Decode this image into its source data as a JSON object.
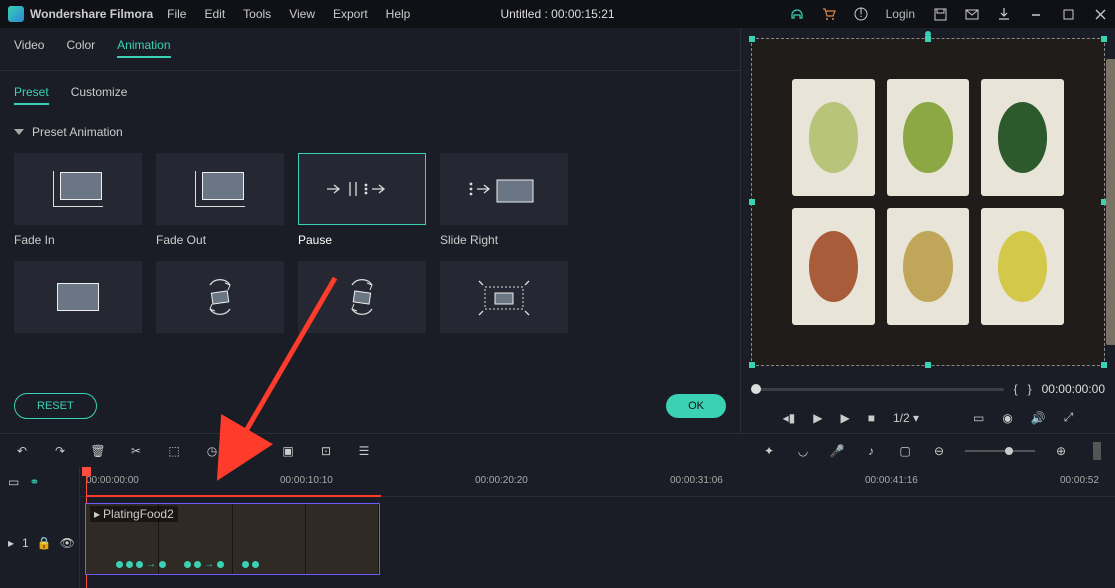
{
  "app_name": "Wondershare Filmora",
  "menu": [
    "File",
    "Edit",
    "Tools",
    "View",
    "Export",
    "Help"
  ],
  "document_title": "Untitled : 00:00:15:21",
  "login_label": "Login",
  "tabs_primary": [
    "Video",
    "Color",
    "Animation"
  ],
  "tabs_primary_active": "Animation",
  "tabs_secondary": [
    "Preset",
    "Customize"
  ],
  "tabs_secondary_active": "Preset",
  "section_title": "Preset Animation",
  "presets": [
    {
      "label": "Fade In"
    },
    {
      "label": "Fade Out"
    },
    {
      "label": "Pause",
      "selected": true
    },
    {
      "label": "Slide Right"
    }
  ],
  "reset_label": "RESET",
  "ok_label": "OK",
  "preview_time": "00:00:00:00",
  "speed_label": "1/2",
  "ruler": [
    "00:00:00:00",
    "00:00:10:10",
    "00:00:20:20",
    "00:00:31:06",
    "00:00:41:16",
    "00:00:52"
  ],
  "clip_name": "PlatingFood2",
  "track_label": "1"
}
